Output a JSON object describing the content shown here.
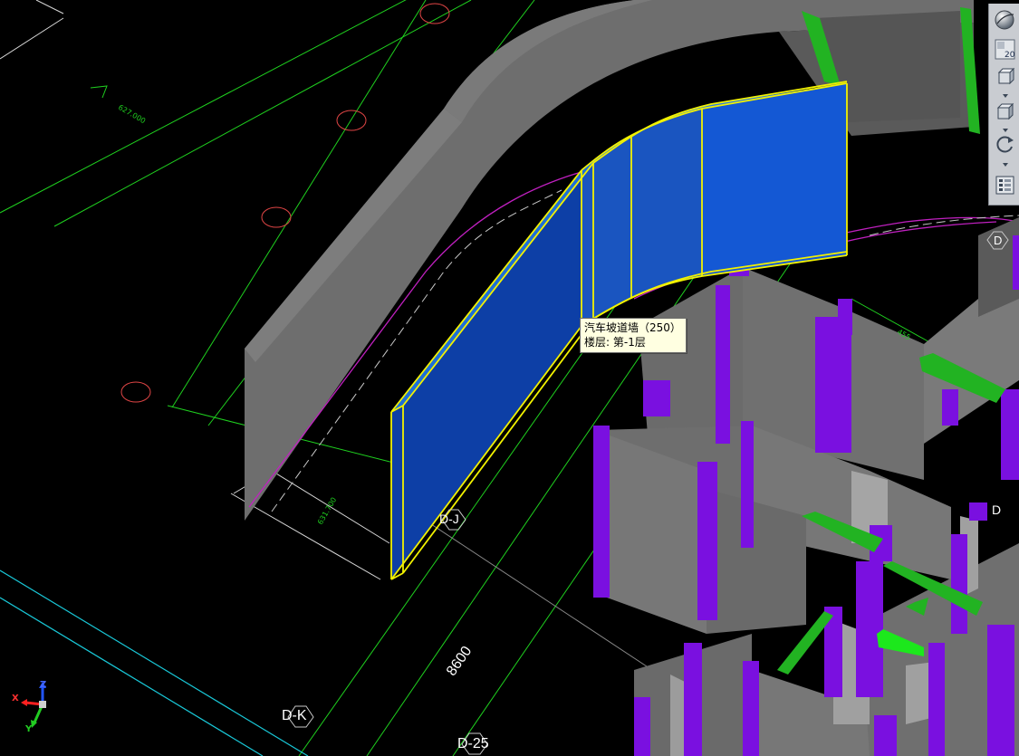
{
  "tooltip": {
    "line1": "汽车坡道墙（250）",
    "line2": "楼层: 第-1层"
  },
  "grid_labels": {
    "dk": "D-K",
    "d25": "D-25",
    "dj": "D-J",
    "d_right_top": "D",
    "d_right_mid": "D"
  },
  "dimension": {
    "value": "8600"
  },
  "toolbar": {
    "zoom_level": "20"
  },
  "axes": {
    "x": "X",
    "y": "Y",
    "z": "Z"
  },
  "colors": {
    "background": "#000000",
    "wall_gray": "#6e6e6e",
    "selected_wall": "#1450c8",
    "selection_outline": "#f2f200",
    "column_purple": "#7a10e0",
    "beam_green": "#22b322",
    "grid_line": "#1fd01f",
    "magenta_line": "#c020c0",
    "cyan_line": "#19c8d8"
  }
}
